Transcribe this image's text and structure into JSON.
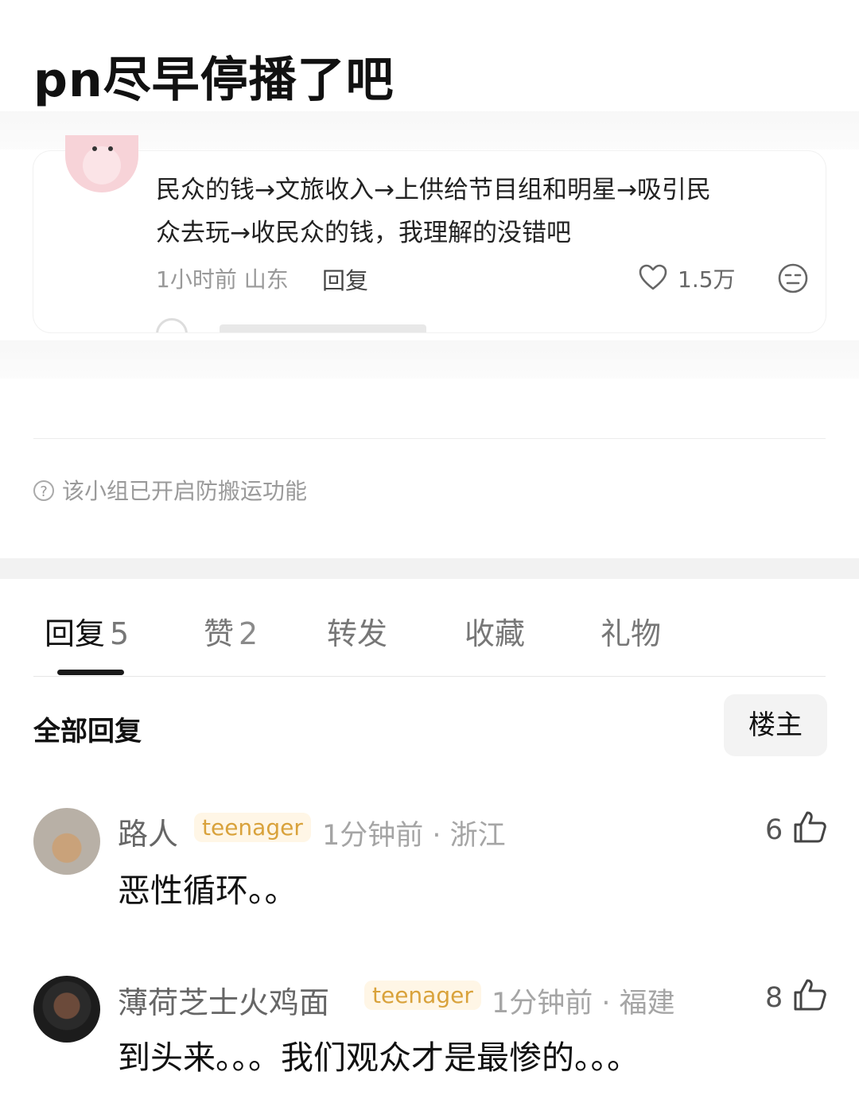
{
  "post": {
    "title": "pn尽早停播了吧"
  },
  "embedded_comment": {
    "text_line1": "民众的钱→文旅收入→上供给节目组和明星→吸引民",
    "text_line2": "众去玩→收民众的钱，我理解的没错吧",
    "meta": "1小时前 山东",
    "reply_label": "回复",
    "likes": "1.5万"
  },
  "notice": {
    "text": "该小组已开启防搬运功能"
  },
  "tabs": [
    {
      "label": "回复",
      "count": "5"
    },
    {
      "label": "赞",
      "count": "2"
    },
    {
      "label": "转发",
      "count": ""
    },
    {
      "label": "收藏",
      "count": ""
    },
    {
      "label": "礼物",
      "count": ""
    }
  ],
  "replies_header": {
    "title": "全部回复",
    "filter_label": "楼主"
  },
  "comments": [
    {
      "user": "路人",
      "badge": "teenager",
      "time": "1分钟前 · 浙江",
      "likes": "6",
      "text": "恶性循环。。"
    },
    {
      "user": "薄荷芝士火鸡面",
      "badge": "teenager",
      "time": "1分钟前 · 福建",
      "likes": "8",
      "text": "到头来。。。我们观众才是最惨的。。。"
    }
  ]
}
